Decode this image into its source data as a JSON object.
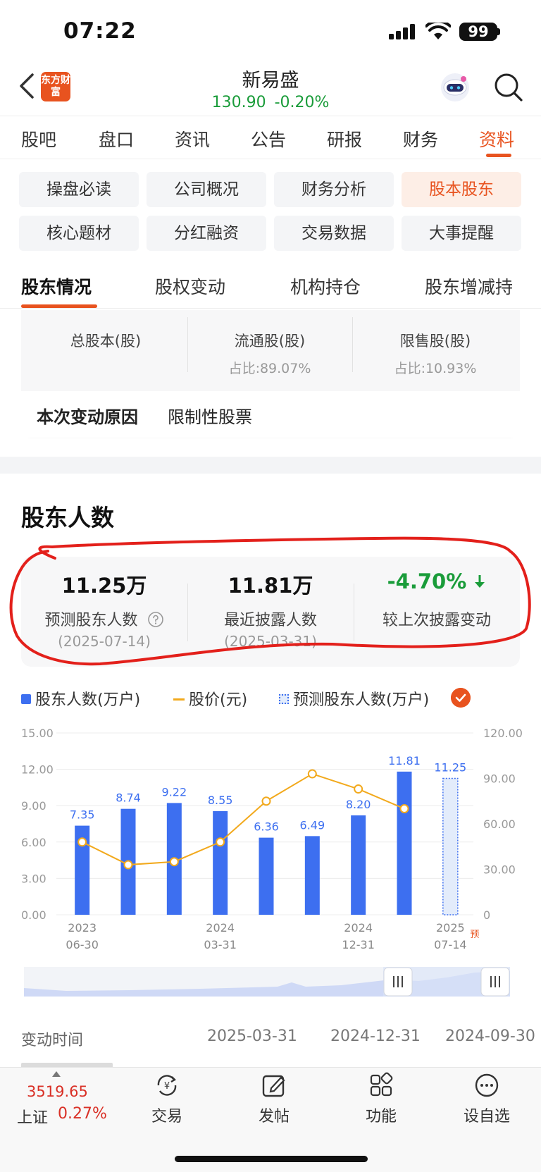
{
  "status_bar": {
    "time": "07:22",
    "battery": "99"
  },
  "header": {
    "logo_text": "东方财富",
    "stock_name": "新易盛",
    "price": "130.90",
    "change_pct": "-0.20%"
  },
  "main_tabs": [
    "股吧",
    "盘口",
    "资讯",
    "公告",
    "研报",
    "财务",
    "资料"
  ],
  "active_main_tab": "资料",
  "sub_buttons": [
    "操盘必读",
    "公司概况",
    "财务分析",
    "股本股东",
    "核心题材",
    "分红融资",
    "交易数据",
    "大事提醒"
  ],
  "active_sub_button": "股本股东",
  "secondary_tabs": [
    "股东情况",
    "股权变动",
    "机构持仓",
    "股东增减持"
  ],
  "active_secondary_tab": "股东情况",
  "share_card": {
    "items": [
      {
        "label": "总股本(股)",
        "sub": ""
      },
      {
        "label": "流通股(股)",
        "sub": "占比:89.07%"
      },
      {
        "label": "限售股(股)",
        "sub": "占比:10.93%"
      }
    ],
    "reason_label": "本次变动原因",
    "reason_value": "限制性股票"
  },
  "holders_section": {
    "title": "股东人数",
    "stats": [
      {
        "value": "11.25万",
        "label": "预测股东人数",
        "date": "(2025-07-14)"
      },
      {
        "value": "11.81万",
        "label": "最近披露人数",
        "date": "(2025-03-31)"
      },
      {
        "value": "-4.70%",
        "label": "较上次披露变动",
        "date": ""
      }
    ],
    "legend": {
      "bars": "股东人数(万户)",
      "line": "股价(元)",
      "forecast": "预测股东人数(万户)"
    }
  },
  "chart_data": {
    "type": "bar",
    "categories": [
      "2023-06-30",
      "",
      "",
      "2024-03-31",
      "",
      "",
      "2024-12-31",
      "",
      "2025-07-14"
    ],
    "x_tick_labels": [
      {
        "index": 0,
        "year": "2023",
        "date": "06-30"
      },
      {
        "index": 3,
        "year": "2024",
        "date": "03-31"
      },
      {
        "index": 6,
        "year": "2024",
        "date": "12-31"
      },
      {
        "index": 8,
        "year": "2025",
        "date": "07-14",
        "tag": "预"
      }
    ],
    "series": [
      {
        "name": "股东人数(万户)",
        "values": [
          7.35,
          8.74,
          9.22,
          8.55,
          6.36,
          6.49,
          8.2,
          11.81,
          null
        ]
      },
      {
        "name": "预测股东人数(万户)",
        "values": [
          null,
          null,
          null,
          null,
          null,
          null,
          null,
          null,
          11.25
        ]
      },
      {
        "name": "股价(元)",
        "axis": "right",
        "values": [
          48,
          33,
          35,
          48,
          75,
          93,
          83,
          70,
          null
        ]
      }
    ],
    "left_axis": {
      "ylim": [
        0,
        15
      ],
      "ticks": [
        "15.00",
        "12.00",
        "9.00",
        "6.00",
        "3.00",
        "0.00"
      ]
    },
    "right_axis": {
      "ylim": [
        0,
        120
      ],
      "ticks": [
        "120.00",
        "90.00",
        "60.00",
        "30.00",
        "0"
      ]
    },
    "grid": true,
    "colors": {
      "bar": "#3d6ff0",
      "line": "#f2a91c",
      "forecast": "#3d6ff0"
    }
  },
  "change_table": {
    "label": "变动时间",
    "dates": [
      "2025-03-31",
      "2024-12-31",
      "2024-09-30"
    ]
  },
  "bottom_nav": {
    "index_value": "3519.65",
    "index_name": "上证",
    "index_change": "0.27%",
    "items": [
      "交易",
      "发帖",
      "功能",
      "设自选"
    ]
  },
  "colors": {
    "accent": "#e8531f",
    "up": "#d93026",
    "down": "#1a9c3a",
    "annotation": "#e3201b"
  }
}
